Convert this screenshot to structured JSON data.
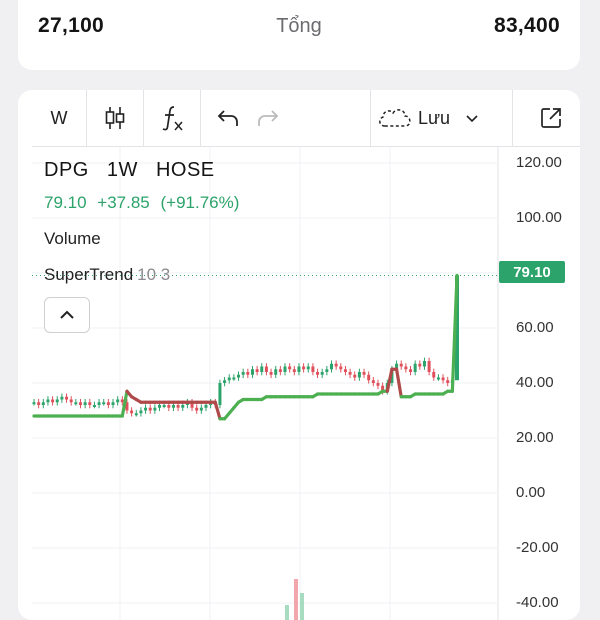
{
  "summary": {
    "left_value": "27,100",
    "label": "Tổng",
    "right_value": "83,400"
  },
  "toolbar": {
    "interval": "W",
    "save_label": "Lưu",
    "icons": [
      "candles-icon",
      "function-icon",
      "undo-icon",
      "redo-icon",
      "cloud-icon",
      "chevron-down-icon",
      "popout-icon"
    ]
  },
  "legend": {
    "symbol": "DPG",
    "interval": "1W",
    "exchange": "HOSE",
    "price": "79.10",
    "change": "+37.85",
    "change_pct": "(+91.76%)",
    "volume": "Volume",
    "indicator": "SuperTrend",
    "indicator_args": "10 3"
  },
  "price_tag": "79.10",
  "colors": {
    "up": "#2ca36a",
    "down": "#e0505b",
    "supertrend_up": "#4caf50",
    "supertrend_down": "#b04a4a"
  },
  "chart_data": {
    "type": "line",
    "y_ticks": [
      "120.00",
      "100.00",
      "80.00",
      "60.00",
      "40.00",
      "20.00",
      "0.00",
      "-20.00",
      "-40.00"
    ],
    "ylim": [
      -45,
      125
    ],
    "last_price": 79.1,
    "series": [
      {
        "name": "DPG",
        "values": [
          33,
          32,
          33,
          34,
          33,
          34,
          35,
          34,
          33,
          33,
          32,
          33,
          32,
          32,
          33,
          33,
          32,
          33,
          34,
          33,
          30,
          29,
          29,
          30,
          31,
          30,
          31,
          32,
          32,
          31,
          32,
          31,
          32,
          33,
          31,
          30,
          31,
          32,
          33,
          32,
          40,
          41,
          42,
          42,
          43,
          44,
          43,
          45,
          44,
          46,
          44,
          43,
          45,
          44,
          46,
          45,
          44,
          46,
          45,
          46,
          44,
          43,
          44,
          45,
          47,
          46,
          45,
          44,
          43,
          42,
          44,
          43,
          41,
          40,
          39,
          37,
          40,
          45,
          47,
          46,
          45,
          44,
          47,
          46,
          48,
          44,
          42,
          42,
          41,
          40,
          41,
          79.1
        ]
      },
      {
        "values": [
          28,
          28,
          28,
          28,
          28,
          28,
          28,
          28,
          28,
          28,
          28,
          28,
          28,
          28,
          28,
          28,
          28,
          28,
          28,
          28,
          37,
          35,
          34,
          33,
          33,
          33,
          33,
          33,
          33,
          33,
          33,
          33,
          33,
          33,
          33,
          33,
          33,
          33,
          33,
          33,
          27,
          27,
          29,
          31,
          33,
          34,
          34,
          34,
          34,
          34,
          35,
          35,
          35,
          35,
          35,
          35,
          35,
          35,
          35,
          35,
          35,
          36,
          36,
          36,
          36,
          36,
          36,
          36,
          36,
          36,
          36,
          36,
          36,
          36,
          36,
          37,
          37,
          45,
          45,
          35,
          35,
          35,
          36,
          36,
          36,
          36,
          36,
          36,
          36,
          37,
          37,
          79.1
        ]
      }
    ]
  }
}
